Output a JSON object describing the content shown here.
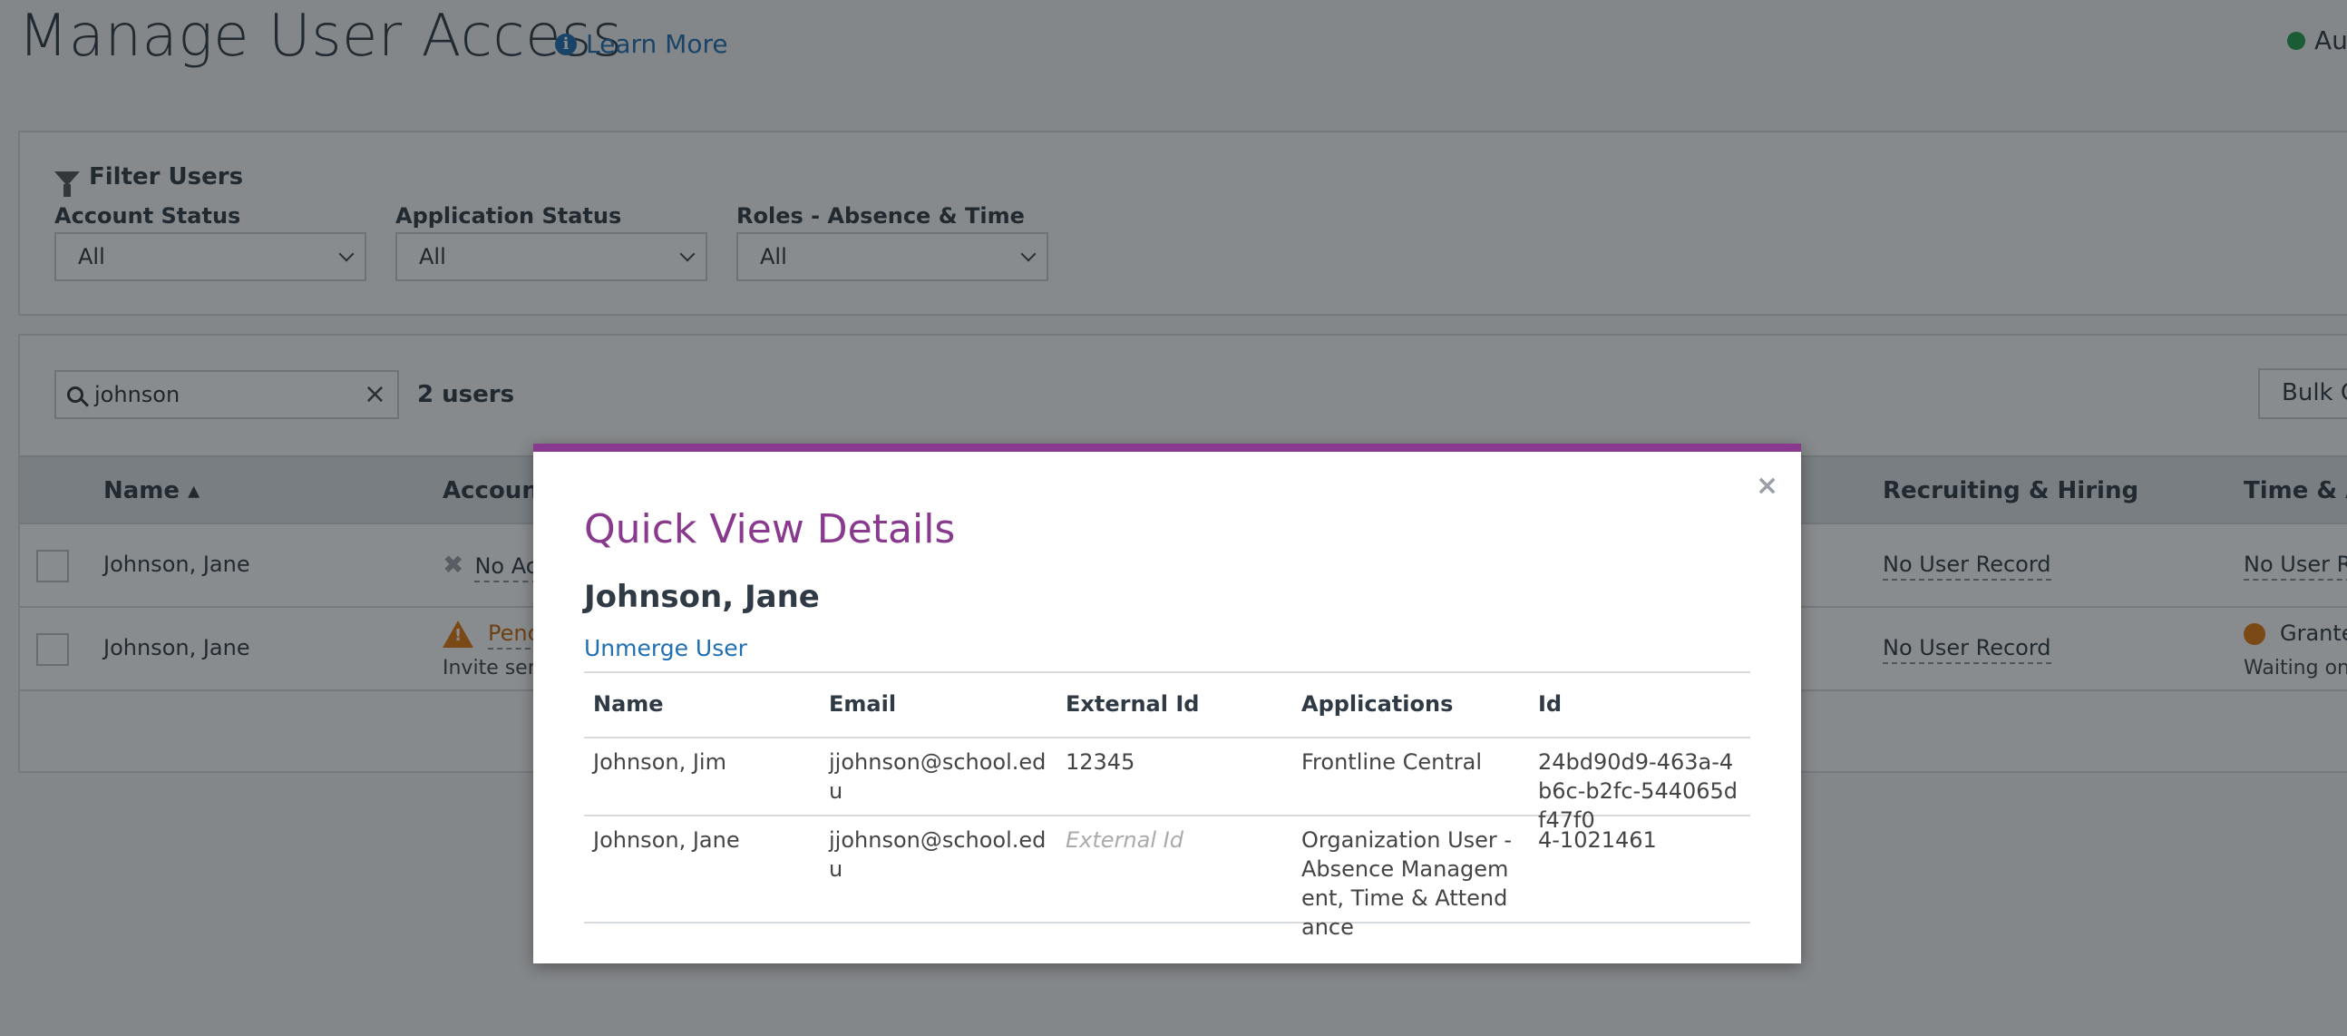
{
  "page": {
    "title": "Manage User Access",
    "learn_more": "Learn More",
    "topright_text": "Au"
  },
  "filters": {
    "title": "Filter Users",
    "items": [
      {
        "label": "Account Status",
        "value": "All"
      },
      {
        "label": "Application Status",
        "value": "All"
      },
      {
        "label": "Roles - Absence & Time",
        "value": "All"
      }
    ]
  },
  "list": {
    "search_value": "johnson",
    "count": "2 users",
    "bulk_label": "Bulk C",
    "columns": {
      "name": "Name ▴",
      "account": "Account",
      "recruiting": "Recruiting & Hiring",
      "time": "Time & At"
    },
    "rows": [
      {
        "name": "Johnson, Jane",
        "account": "No Ac",
        "recruiting": "No User Record",
        "time": "No User R"
      },
      {
        "name": "Johnson, Jane",
        "account": "Penc",
        "account_sub": "Invite sen",
        "recruiting": "No User Record",
        "time": "Grante",
        "time_sub": "Waiting on"
      }
    ]
  },
  "modal": {
    "title": "Quick View Details",
    "close": "×",
    "user_name": "Johnson, Jane",
    "unmerge": "Unmerge User",
    "columns": [
      "Name",
      "Email",
      "External Id",
      "Applications",
      "Id"
    ],
    "rows": [
      {
        "name": "Johnson, Jim",
        "email": "jjohnson@school.edu",
        "external_id": "12345",
        "applications": "Frontline Central",
        "id": "24bd90d9-463a-4b6c-b2fc-544065df47f0"
      },
      {
        "name": "Johnson, Jane",
        "email": "jjohnson@school.edu",
        "external_id": "",
        "external_id_placeholder": "External Id",
        "applications": "Organization User - Absence Management, Time & Attendance",
        "id": "4-1021461"
      }
    ]
  },
  "colors": {
    "modal_accent": "#8a3a8e",
    "link": "#1f6fb2",
    "status_green": "#1e9e4d",
    "status_orange": "#e0780f"
  }
}
